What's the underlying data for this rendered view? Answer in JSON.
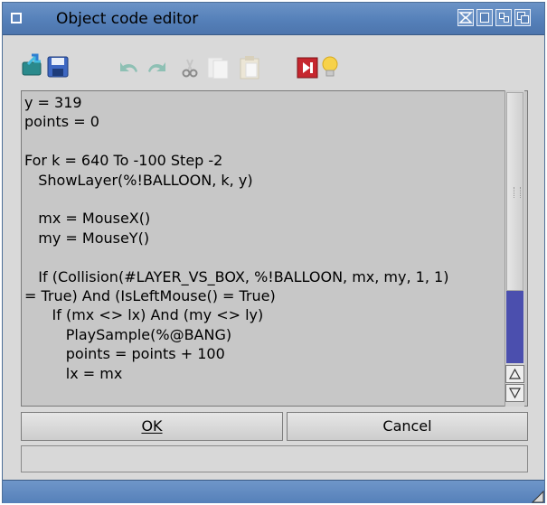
{
  "window": {
    "title": "Object code editor",
    "title_gadgets": [
      "close-icon",
      "depth-icon",
      "zoom-icon",
      "iconify-icon",
      "restore-icon"
    ]
  },
  "toolbar": {
    "items": [
      {
        "name": "load-icon",
        "enabled": true
      },
      {
        "name": "save-icon",
        "enabled": true
      },
      {
        "name": "undo-icon",
        "enabled": false
      },
      {
        "name": "redo-icon",
        "enabled": false
      },
      {
        "name": "cut-icon",
        "enabled": false
      },
      {
        "name": "copy-icon",
        "enabled": false
      },
      {
        "name": "paste-icon",
        "enabled": false
      },
      {
        "name": "run-icon",
        "enabled": true
      },
      {
        "name": "help-bulb-icon",
        "enabled": true
      }
    ]
  },
  "editor": {
    "lines": [
      "y = 319",
      "points = 0",
      "",
      "For k = 640 To -100 Step -2",
      "   ShowLayer(%!BALLOON, k, y)",
      "",
      "   mx = MouseX()",
      "   my = MouseY()",
      "",
      "   If (Collision(#LAYER_VS_BOX, %!BALLOON, mx, my, 1, 1)",
      "= True) And (IsLeftMouse() = True)",
      "      If (mx <> lx) And (my <> ly)",
      "         PlaySample(%@BANG)",
      "         points = points + 100",
      "         lx = mx"
    ]
  },
  "buttons": {
    "ok_label": "OK",
    "cancel_label": "Cancel"
  },
  "status": {
    "text": ""
  },
  "colors": {
    "title_bar": "#5580b9",
    "editor_bg": "#c7c7c7",
    "scroll_thumb": "#4b4fae"
  }
}
